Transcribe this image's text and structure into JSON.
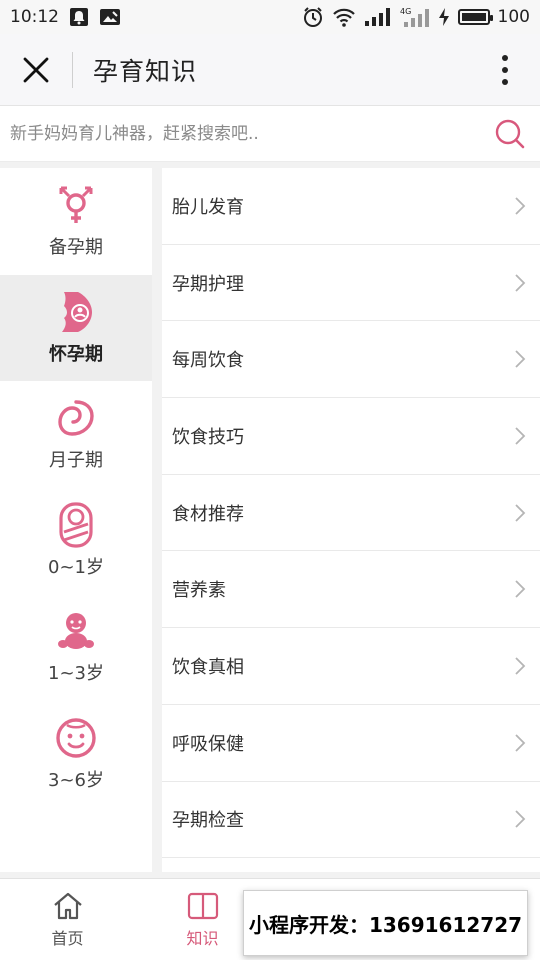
{
  "status": {
    "time": "10:12",
    "battery": "100",
    "network": "4G"
  },
  "header": {
    "title": "孕育知识"
  },
  "search": {
    "placeholder": "新手妈妈育儿神器，赶紧搜索吧.."
  },
  "sidebar": {
    "items": [
      {
        "label": "备孕期",
        "icon": "gender-symbol-icon",
        "active": false
      },
      {
        "label": "怀孕期",
        "icon": "pregnant-belly-icon",
        "active": true
      },
      {
        "label": "月子期",
        "icon": "postpartum-icon",
        "active": false
      },
      {
        "label": "0~1岁",
        "icon": "swaddled-baby-icon",
        "active": false
      },
      {
        "label": "1~3岁",
        "icon": "toddler-icon",
        "active": false
      },
      {
        "label": "3~6岁",
        "icon": "child-face-icon",
        "active": false
      }
    ]
  },
  "list": {
    "items": [
      {
        "label": "胎儿发育"
      },
      {
        "label": "孕期护理"
      },
      {
        "label": "每周饮食"
      },
      {
        "label": "饮食技巧"
      },
      {
        "label": "食材推荐"
      },
      {
        "label": "营养素"
      },
      {
        "label": "饮食真相"
      },
      {
        "label": "呼吸保健"
      },
      {
        "label": "孕期检查"
      }
    ]
  },
  "tabbar": {
    "items": [
      {
        "label": "首页",
        "icon": "home-icon",
        "active": false
      },
      {
        "label": "知识",
        "icon": "book-icon",
        "active": true
      }
    ]
  },
  "promo": {
    "text": "小程序开发：13691612727"
  },
  "colors": {
    "accent": "#e0678b",
    "active_tab": "#d65a7a"
  }
}
